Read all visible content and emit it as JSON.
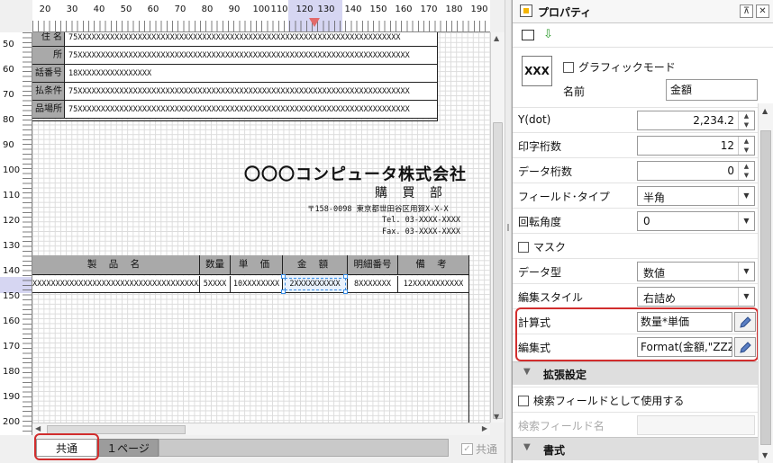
{
  "ruler": {
    "top_labels": [
      "20",
      "30",
      "40",
      "50",
      "60",
      "70",
      "80",
      "90",
      "100",
      "110",
      "120",
      "130",
      "140",
      "150",
      "160",
      "170",
      "180",
      "190"
    ],
    "left_labels": [
      "50",
      "60",
      "70",
      "80",
      "90",
      "100",
      "110",
      "120",
      "130",
      "140",
      "150",
      "160",
      "170",
      "180",
      "190",
      "200"
    ]
  },
  "form": {
    "header_rows": [
      {
        "label": "住 名",
        "value": "75XXXXXXXXXXXXXXXXXXXXXXXXXXXXXXXXXXXXXXXXXXXXXXXXXXXXXXXXXXXXXXXXXXXXXX"
      },
      {
        "label": "所",
        "value": "75XXXXXXXXXXXXXXXXXXXXXXXXXXXXXXXXXXXXXXXXXXXXXXXXXXXXXXXXXXXXXXXXXXXXXXXX"
      },
      {
        "label": "話番号",
        "value": "18XXXXXXXXXXXXXXXX"
      },
      {
        "label": "払条件",
        "value": "75XXXXXXXXXXXXXXXXXXXXXXXXXXXXXXXXXXXXXXXXXXXXXXXXXXXXXXXXXXXXXXXXXXXXXXXX"
      },
      {
        "label": "品場所",
        "value": "75XXXXXXXXXXXXXXXXXXXXXXXXXXXXXXXXXXXXXXXXXXXXXXXXXXXXXXXXXXXXXXXXXXXXXXXX"
      }
    ],
    "company_name": "〇〇〇コンピュータ株式会社",
    "department": "購 買 部",
    "address_lines": [
      "〒158-0098 東京都世田谷区用賀X-X-X",
      "Tel. 03-XXXX-XXXX",
      "Fax. 03-XXXX-XXXX"
    ],
    "item_headers": [
      "製 品 名",
      "数量",
      "単 価",
      "金 額",
      "明細番号",
      "備 考"
    ],
    "item_row": [
      "XXXXXXXXXXXXXXXXXXXXXXXXXXXXXXXXXXXXXX",
      "5XXXX",
      "10XXXXXXXX",
      "2XXXXXXXXXX",
      "8XXXXXXX",
      "12XXXXXXXXXXX"
    ]
  },
  "tabs": {
    "common": "共通",
    "page1": "１ページ",
    "common_check": "共通"
  },
  "panel": {
    "title": "プロパティ",
    "pin_icon": "pin-icon",
    "close_icon": "close-icon",
    "preview_text": "XXX",
    "graphic_mode_label": "グラフィックモード",
    "name_label": "名前",
    "name_value": "金額",
    "props": {
      "y_dot": {
        "label": "Y(dot)",
        "value": "2,234.2"
      },
      "print_digits": {
        "label": "印字桁数",
        "value": "12"
      },
      "data_digits": {
        "label": "データ桁数",
        "value": "0"
      },
      "field_type": {
        "label": "フィールド･タイプ",
        "value": "半角"
      },
      "rotation": {
        "label": "回転角度",
        "value": "0"
      },
      "mask": {
        "label": "マスク"
      },
      "data_type": {
        "label": "データ型",
        "value": "数値"
      },
      "edit_style": {
        "label": "編集スタイル",
        "value": "右詰め"
      },
      "formula": {
        "label": "計算式",
        "value": "数量*単価"
      },
      "format": {
        "label": "編集式",
        "value": "Format(金額,\"ZZZ"
      }
    },
    "section_extended": "拡張設定",
    "use_search_field": "検索フィールドとして使用する",
    "search_field_name": "検索フィールド名",
    "section_format": "書式"
  },
  "colors": {
    "highlight_red": "#d12d2d",
    "ruler_highlight": "#d6d6f2",
    "selection_blue": "#3a8ee6",
    "header_gray": "#a9a9a9"
  }
}
